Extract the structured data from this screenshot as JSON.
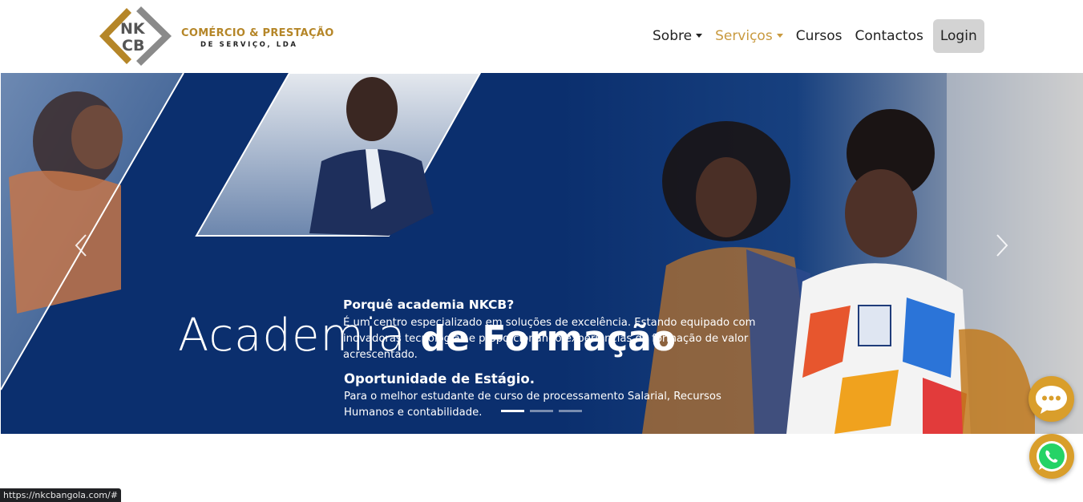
{
  "brand": {
    "monogram_top": "NK",
    "monogram_bottom": "CB",
    "name_line1": "COMÉRCIO & PRESTAÇÃO",
    "name_line2": "DE SERVIÇO, LDA",
    "gold": "#b58628",
    "navy": "#0b2f6e"
  },
  "nav": {
    "items": [
      {
        "label": "Sobre",
        "dropdown": true,
        "active": false
      },
      {
        "label": "Serviços",
        "dropdown": true,
        "active": true
      },
      {
        "label": "Cursos",
        "dropdown": false,
        "active": false
      },
      {
        "label": "Contactos",
        "dropdown": false,
        "active": false
      }
    ],
    "login_label": "Login"
  },
  "hero": {
    "title_light": "Academia",
    "title_bold": "de Formação",
    "section1_heading": "Porquê academia NKCB?",
    "section1_text": "É um centro especializado em soluções de excelência. Estando equipado com inovadoras tecnologias e proporcionando experiências de formação de valor acrescentado.",
    "section2_heading": "Oportunidade de Estágio.",
    "section2_text": "Para o melhor estudante de curso de processamento Salarial, Recursos Humanos e contabilidade.",
    "slides_total": 3,
    "active_slide": 1,
    "prev_icon": "chevron-left-icon",
    "next_icon": "chevron-right-icon"
  },
  "floating": {
    "chat_icon": "chat-bubble-icon",
    "whatsapp_icon": "whatsapp-icon",
    "accent": "#d99e2b"
  },
  "status_bar": {
    "url": "https://nkcbangola.com/#"
  }
}
